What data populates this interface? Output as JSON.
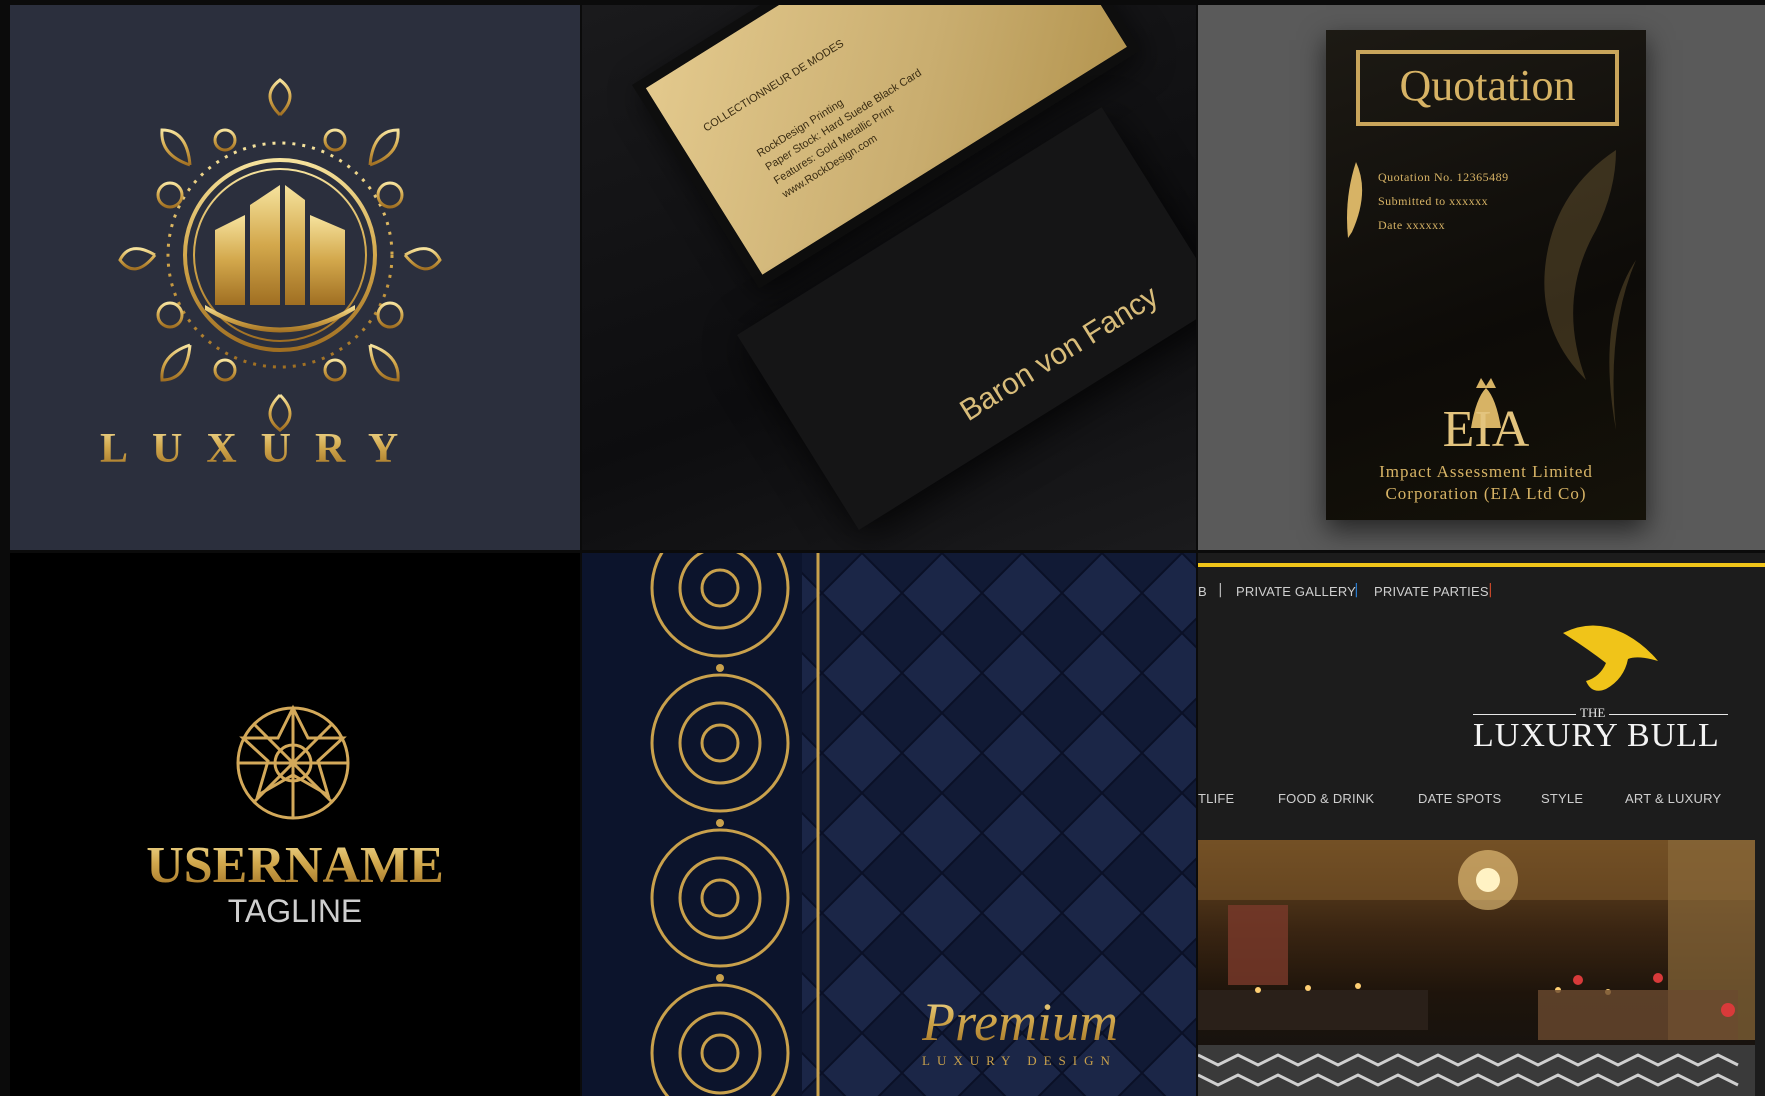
{
  "tiles": {
    "luxury_logo": {
      "wordmark": "LUXURY"
    },
    "business_card": {
      "company_line": "COLLECTIONNEUR DE MODES",
      "details": [
        "RockDesign Printing",
        "Paper Stock: Hard Suede Black Card",
        "Features: Gold Metallic Print",
        "www.RockDesign.com"
      ],
      "name": "Baron von Fancy"
    },
    "quotation": {
      "title": "Quotation",
      "fields": [
        "Quotation No. 12365489",
        "Submitted to xxxxxx",
        "Date xxxxxx"
      ],
      "logo_text": "EIA",
      "company": [
        "Impact Assessment Limited",
        "Corporation (EIA Ltd Co)"
      ]
    },
    "username_logo": {
      "name": "USERNAME",
      "tagline": "TAGLINE"
    },
    "premium": {
      "script": "Premium",
      "subtitle": "LUXURY DESIGN"
    },
    "luxury_bull": {
      "top_nav": [
        "B",
        "PRIVATE GALLERY",
        "PRIVATE PARTIES"
      ],
      "logo_the": "THE",
      "logo_name": "LUXURY BULL",
      "main_nav": [
        "TLIFE",
        "FOOD & DRINK",
        "DATE SPOTS",
        "STYLE",
        "ART & LUXURY"
      ],
      "accent_color": "#f0c419"
    }
  },
  "colors": {
    "gold": "#d6b15a",
    "navy": "#2b2f3d",
    "bull_bg": "#1c1c1c"
  }
}
